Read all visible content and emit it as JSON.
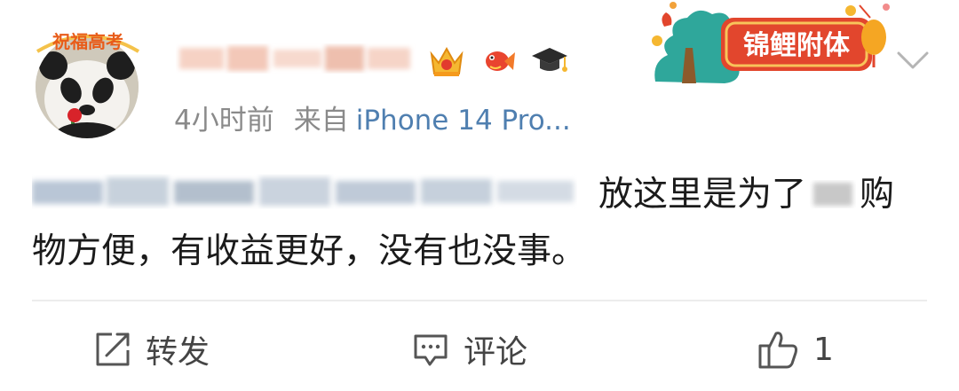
{
  "author": {
    "avatar_badge": "祝福高考",
    "name": ""
  },
  "post": {
    "time": "4小时前",
    "from_label": "来自",
    "device": "iPhone 14 Pro...",
    "text_part1": "放这里是为了",
    "text_part2": "购物方便，有收益更好，没有也没事。"
  },
  "pendant": {
    "label": "锦鲤附体"
  },
  "badges": [
    "crown-badge-icon",
    "fish-badge-icon",
    "graduation-cap-badge-icon"
  ],
  "actions": {
    "repost_label": "转发",
    "comment_label": "评论",
    "like_count": "1"
  },
  "colors": {
    "device_link": "#4f7fb0",
    "meta_gray": "#8a8a8a",
    "pendant_red": "#e2462d",
    "pendant_teal": "#2fa79b"
  }
}
